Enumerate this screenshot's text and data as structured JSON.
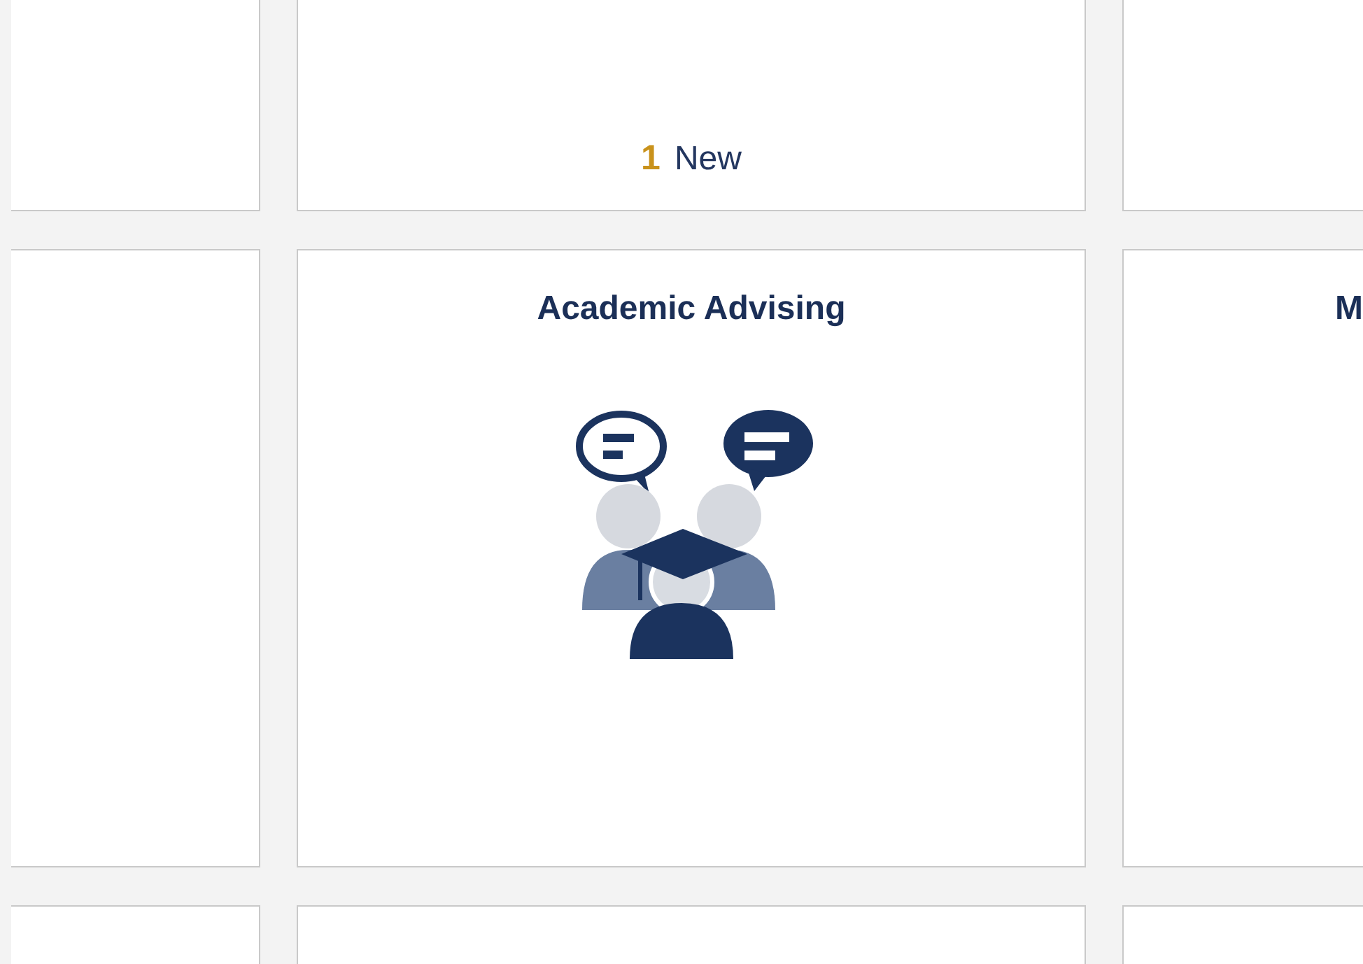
{
  "rows": [
    {
      "tiles": [
        {
          "kind": "empty"
        },
        {
          "kind": "count",
          "count": "1",
          "label": "New"
        },
        {
          "kind": "empty"
        }
      ]
    },
    {
      "tiles": [
        {
          "kind": "empty"
        },
        {
          "kind": "icon",
          "title": "Academic Advising"
        },
        {
          "kind": "title",
          "title": "M"
        }
      ]
    },
    {
      "tiles": [
        {
          "kind": "empty"
        },
        {
          "kind": "empty"
        },
        {
          "kind": "empty"
        }
      ]
    }
  ]
}
